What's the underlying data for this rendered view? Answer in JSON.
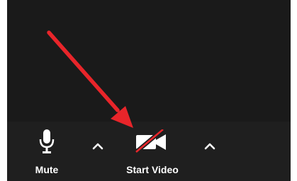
{
  "toolbar": {
    "mute": {
      "label": "Mute",
      "icon": "microphone-icon"
    },
    "audio_options": {
      "icon": "chevron-up-icon"
    },
    "start_video": {
      "label": "Start Video",
      "icon": "video-camera-off-icon"
    },
    "video_options": {
      "icon": "chevron-up-icon"
    }
  },
  "annotation": {
    "icon": "red-arrow-icon",
    "color": "#e8252a"
  }
}
